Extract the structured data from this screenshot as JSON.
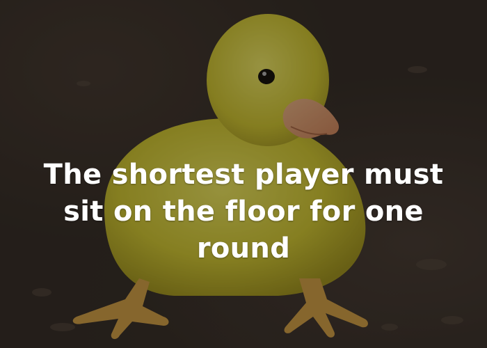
{
  "card": {
    "caption": "The shortest player must sit on the floor for one round"
  },
  "colors": {
    "caption_text": "#ffffff",
    "duckling_body": "#dcd238",
    "beak": "#e8a878",
    "feet": "#d9a54a",
    "ground": "#3a312a"
  }
}
